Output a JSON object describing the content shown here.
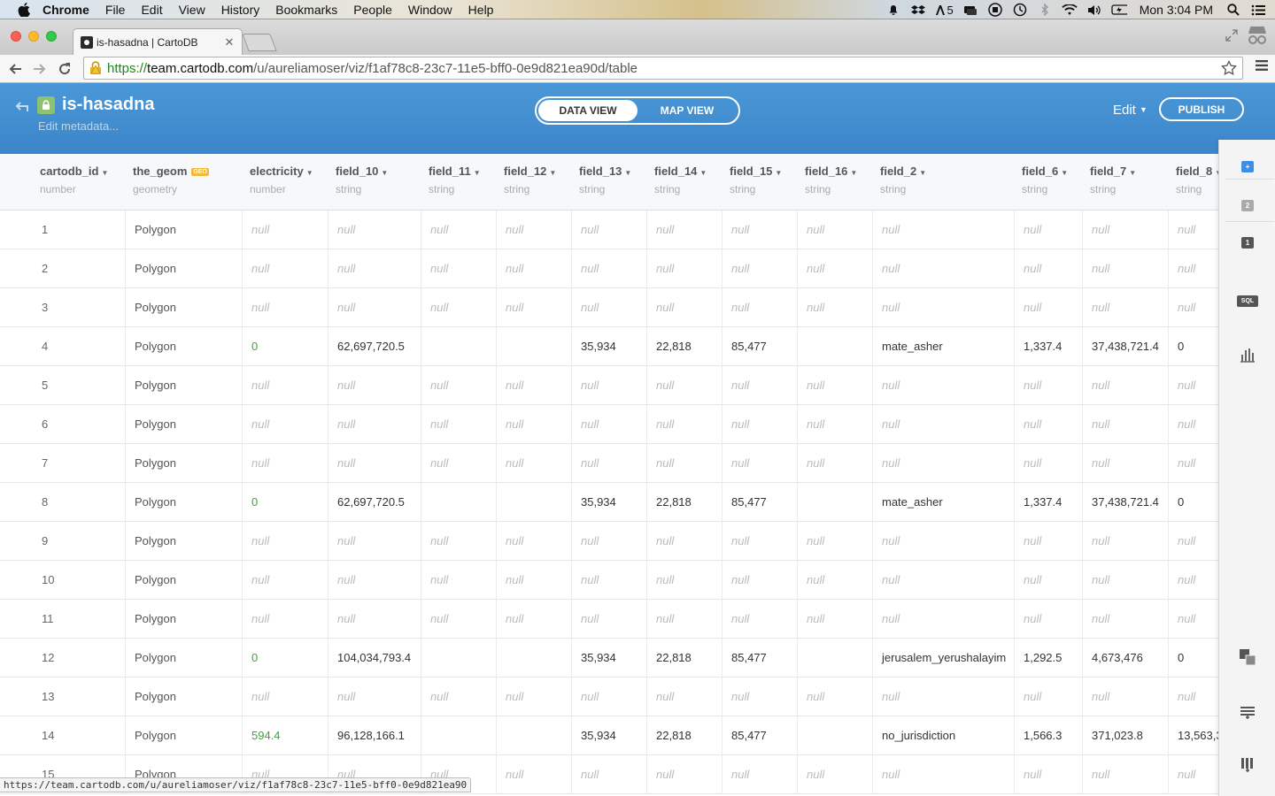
{
  "os_menubar": {
    "app_name": "Chrome",
    "menus": [
      "File",
      "Edit",
      "View",
      "History",
      "Bookmarks",
      "People",
      "Window",
      "Help"
    ],
    "status_count": "5",
    "clock": "Mon 3:04 PM"
  },
  "browser": {
    "tab_title": "is-hasadna | CartoDB",
    "url_scheme": "https://",
    "url_host": "team.cartodb.com",
    "url_path": "/u/aureliamoser/viz/f1af78c8-23c7-11e5-bff0-0e9d821ea90d/table",
    "status_url": "https://team.cartodb.com/u/aureliamoser/viz/f1af78c8-23c7-11e5-bff0-0e9d821ea90"
  },
  "header": {
    "table_name": "is-hasadna",
    "edit_metadata": "Edit metadata...",
    "data_view": "DATA VIEW",
    "map_view": "MAP VIEW",
    "edit_menu": "Edit",
    "publish": "PUBLISH"
  },
  "table": {
    "columns": [
      {
        "name": "cartodb_id",
        "type": "number"
      },
      {
        "name": "the_geom",
        "type": "geometry",
        "badge": "GEO"
      },
      {
        "name": "electricity",
        "type": "number"
      },
      {
        "name": "field_10",
        "type": "string"
      },
      {
        "name": "field_11",
        "type": "string"
      },
      {
        "name": "field_12",
        "type": "string"
      },
      {
        "name": "field_13",
        "type": "string"
      },
      {
        "name": "field_14",
        "type": "string"
      },
      {
        "name": "field_15",
        "type": "string"
      },
      {
        "name": "field_16",
        "type": "string"
      },
      {
        "name": "field_2",
        "type": "string"
      },
      {
        "name": "field_6",
        "type": "string"
      },
      {
        "name": "field_7",
        "type": "string"
      },
      {
        "name": "field_8",
        "type": "string"
      }
    ],
    "rows": [
      [
        "1",
        "Polygon",
        "null",
        "null",
        "null",
        "null",
        "null",
        "null",
        "null",
        "null",
        "null",
        "null",
        "null",
        "null"
      ],
      [
        "2",
        "Polygon",
        "null",
        "null",
        "null",
        "null",
        "null",
        "null",
        "null",
        "null",
        "null",
        "null",
        "null",
        "null"
      ],
      [
        "3",
        "Polygon",
        "null",
        "null",
        "null",
        "null",
        "null",
        "null",
        "null",
        "null",
        "null",
        "null",
        "null",
        "null"
      ],
      [
        "4",
        "Polygon",
        "0",
        "62,697,720.5",
        "",
        "",
        "35,934",
        "22,818",
        "85,477",
        "",
        "mate_asher",
        "1,337.4",
        "37,438,721.4",
        "0"
      ],
      [
        "5",
        "Polygon",
        "null",
        "null",
        "null",
        "null",
        "null",
        "null",
        "null",
        "null",
        "null",
        "null",
        "null",
        "null"
      ],
      [
        "6",
        "Polygon",
        "null",
        "null",
        "null",
        "null",
        "null",
        "null",
        "null",
        "null",
        "null",
        "null",
        "null",
        "null"
      ],
      [
        "7",
        "Polygon",
        "null",
        "null",
        "null",
        "null",
        "null",
        "null",
        "null",
        "null",
        "null",
        "null",
        "null",
        "null"
      ],
      [
        "8",
        "Polygon",
        "0",
        "62,697,720.5",
        "",
        "",
        "35,934",
        "22,818",
        "85,477",
        "",
        "mate_asher",
        "1,337.4",
        "37,438,721.4",
        "0"
      ],
      [
        "9",
        "Polygon",
        "null",
        "null",
        "null",
        "null",
        "null",
        "null",
        "null",
        "null",
        "null",
        "null",
        "null",
        "null"
      ],
      [
        "10",
        "Polygon",
        "null",
        "null",
        "null",
        "null",
        "null",
        "null",
        "null",
        "null",
        "null",
        "null",
        "null",
        "null"
      ],
      [
        "11",
        "Polygon",
        "null",
        "null",
        "null",
        "null",
        "null",
        "null",
        "null",
        "null",
        "null",
        "null",
        "null",
        "null"
      ],
      [
        "12",
        "Polygon",
        "0",
        "104,034,793.4",
        "",
        "",
        "35,934",
        "22,818",
        "85,477",
        "",
        "jerusalem_yerushalayim",
        "1,292.5",
        "4,673,476",
        "0"
      ],
      [
        "13",
        "Polygon",
        "null",
        "null",
        "null",
        "null",
        "null",
        "null",
        "null",
        "null",
        "null",
        "null",
        "null",
        "null"
      ],
      [
        "14",
        "Polygon",
        "594.4",
        "96,128,166.1",
        "",
        "",
        "35,934",
        "22,818",
        "85,477",
        "",
        "no_jurisdiction",
        "1,566.3",
        "371,023.8",
        "13,563,3"
      ],
      [
        "15",
        "Polygon",
        "null",
        "null",
        "null",
        "null",
        "null",
        "null",
        "null",
        "null",
        "null",
        "null",
        "null",
        "null"
      ]
    ]
  },
  "right_panel": {
    "layer_badges": [
      "+",
      "2",
      "1"
    ],
    "sql_label": "SQL"
  },
  "colors": {
    "header_blue": "#3b86c8",
    "green_value": "#3ea33e",
    "geo_badge": "#f2b93b",
    "lock_badge": "#8dc26f"
  }
}
